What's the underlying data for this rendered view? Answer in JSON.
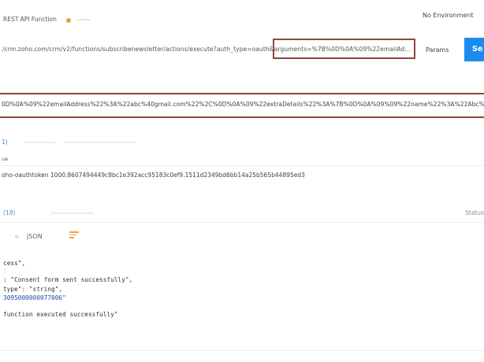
{
  "tab": {
    "title": "REST API Function"
  },
  "environment": {
    "label": "No Environment"
  },
  "request": {
    "url": "/crm.zoho.com/crm/v2/functions/subscribenewsletter/actions/execute?auth_type=oauth&arguments=%7B%0D%0A%09%22emailAd...",
    "params_label": "Params",
    "send_label": "Se"
  },
  "arguments_value": "0D%0A%09%22emailAddress%22%3A%22abc%40gmail.com%22%2C%0D%0A%09%22extraDetails%22%3A%7B%0D%0A%09%09%22name%22%3A%22Abc%2",
  "headers": {
    "tab_label": "1)",
    "key_label": "ue",
    "row_value": "oho-oauthtoken 1000.8607494449c8bc1e392acc95183c0ef9.1511d2349bd6bb14a25b565b44895ed3"
  },
  "response": {
    "tab_label": "(18)",
    "status_label": "Status",
    "json_label": "JSON",
    "caret": "<",
    "lines": [
      "cess\",",
      ":",
      ": \"Consent form sent successfully\",",
      "type\": \"string\",",
      "3095000000077006\"",
      "",
      "function executed successfully\""
    ]
  },
  "colors": {
    "send_button": "#1a8cf0",
    "highlight_border": "#8a4a3a",
    "tab_dot": "#f39a3b"
  }
}
